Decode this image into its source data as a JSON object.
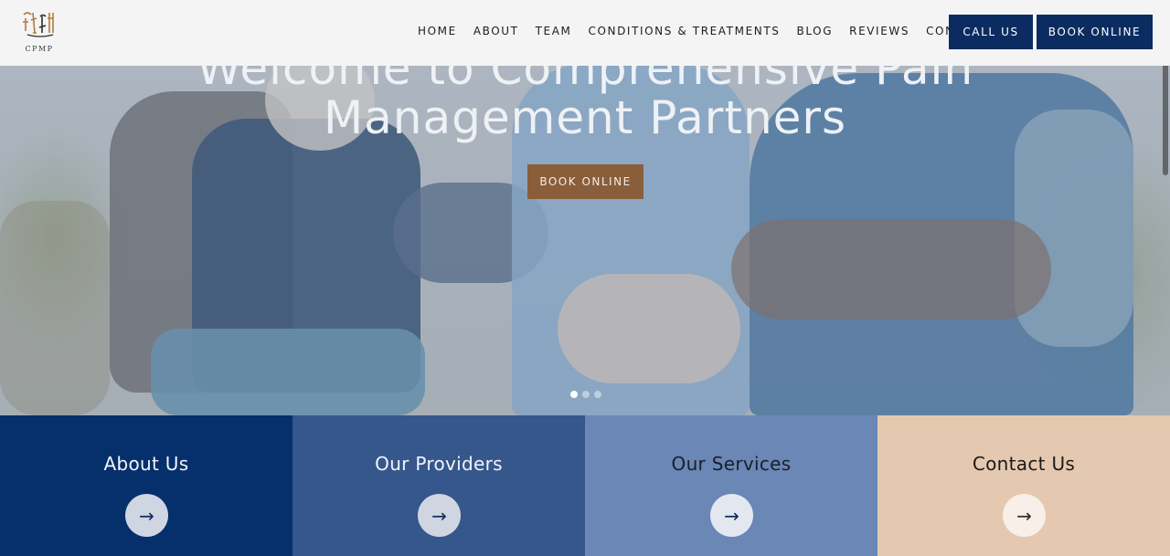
{
  "logo": {
    "text": "CPMP",
    "color": "#b27a3e"
  },
  "nav": {
    "items": [
      "HOME",
      "ABOUT",
      "TEAM",
      "CONDITIONS & TREATMENTS",
      "BLOG",
      "REVIEWS",
      "CONTACT"
    ],
    "call_label": "CALL US",
    "book_label": "BOOK ONLINE"
  },
  "hero": {
    "title_line1": "Welcome to Comprehensive Pain",
    "title_line2": "Management Partners",
    "button_label": "BOOK ONLINE",
    "slides": 3,
    "active_slide": 1
  },
  "tiles": [
    {
      "label": "About Us",
      "bg": "#05306b",
      "text_color": "#f2f4f8",
      "arrow_bg": "#cfd6e2",
      "arrow_color": "#0f2b5a"
    },
    {
      "label": "Our Providers",
      "bg": "#36578b",
      "text_color": "#f2f4f8",
      "arrow_bg": "#cfd6e2",
      "arrow_color": "#0f2b5a"
    },
    {
      "label": "Our Services",
      "bg": "#6a87b5",
      "text_color": "#1a1f2a",
      "arrow_bg": "#e3e8f0",
      "arrow_color": "#0f2b5a"
    },
    {
      "label": "Contact Us",
      "bg": "#e4c9b0",
      "text_color": "#1a1a1a",
      "arrow_bg": "#f7efe8",
      "arrow_color": "#2b2b2b"
    }
  ],
  "arrow_glyph": "→",
  "colors": {
    "navy": "#0b2c61",
    "accent_brown": "#8a5e3b"
  }
}
